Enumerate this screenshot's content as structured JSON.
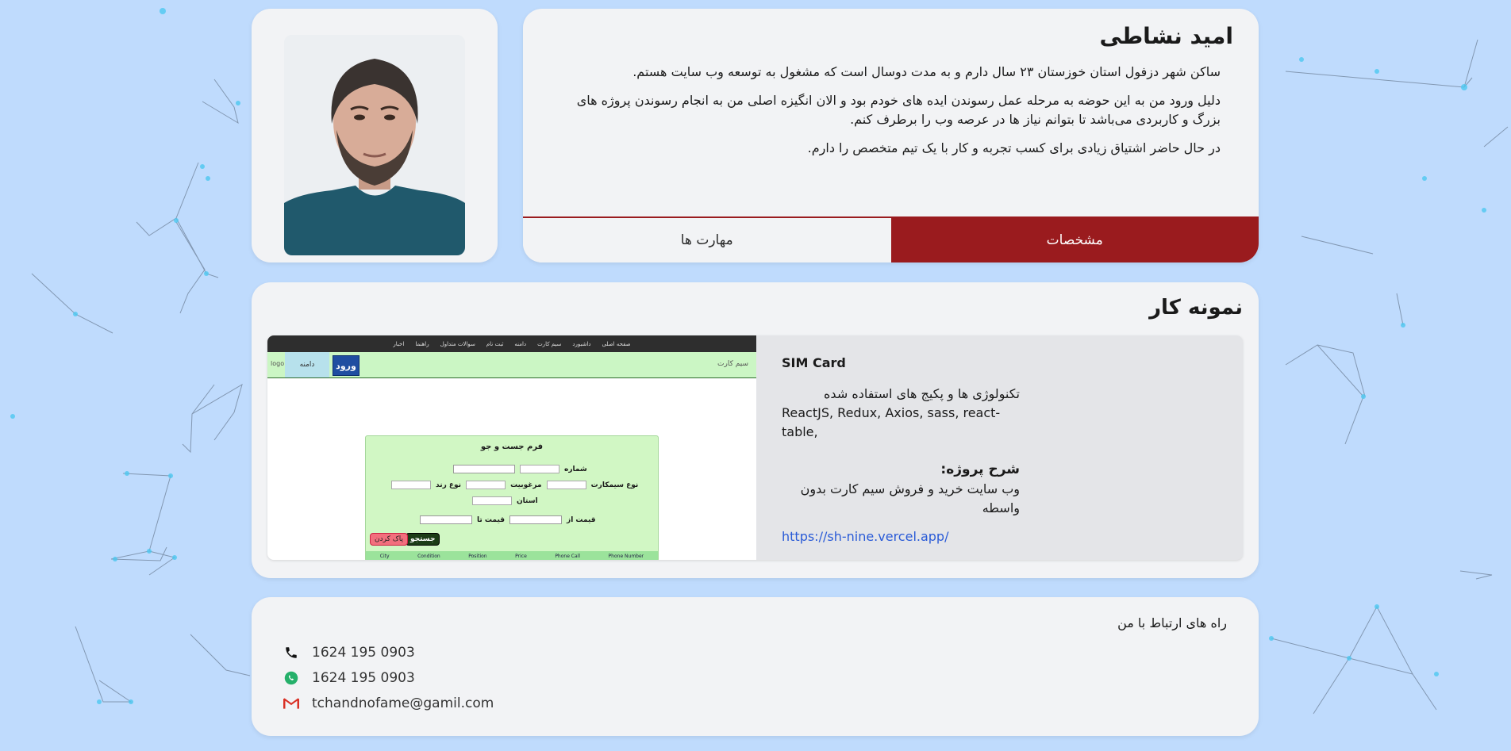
{
  "profile": {
    "name": "امید نشاطی",
    "paragraphs": [
      "ساکن شهر دزفول استان خوزستان ۲۳ سال دارم و به مدت دوسال است که مشغول به توسعه وب سایت هستم.",
      "دلیل ورود من به این حوضه به مرحله عمل رسوندن ایده های خودم بود و الان انگیزه اصلی من به انجام رسوندن پروژه های بزرگ و کاربردی می‌باشد تا بتوانم نیاز ها در عرصه وب را برطرف کنم.",
      "در حال حاضر اشتیاق زیادی برای کسب تجربه و کار با یک تیم متخصص را دارم."
    ],
    "tabs": {
      "skills": "مهارت ها",
      "specs": "مشخصات"
    },
    "active_tab": "specs"
  },
  "portfolio": {
    "title": "نمونه کار",
    "project": {
      "name": "SIM Card",
      "tech_title": "تکنولوژی ها و پکیج های استفاده شده",
      "tech": "ReactJS, Redux, Axios, sass, react-table,",
      "desc_title": "شرح پروژه:",
      "desc": "وب سایت خرید و فروش سیم کارت بدون واسطه",
      "link": "https://sh-nine.vercel.app/",
      "screenshot": {
        "nav": [
          "صفحه اصلی",
          "داشبورد",
          "سیم کارت",
          "دامنه",
          "ثبت نام",
          "سوالات متداول",
          "راهنما",
          "اخبار"
        ],
        "logo": "logo",
        "domain": "دامنه",
        "login": "ورود",
        "brand": "سیم کارت",
        "form_title": "فرم جست و جو",
        "number_label": "شماره",
        "simtype_label": "نوع سیمکارت",
        "status_label": "مرغوبیت",
        "pattern_label": "نوع رند",
        "province_label": "استان",
        "price_from_label": "قیمت از",
        "price_to_label": "قیمت تا",
        "search_btn": "جستجو",
        "clear_btn": "پاک کردن",
        "table_cols": [
          "City",
          "Condition",
          "Position",
          "Price",
          "Phone Call",
          "Phone Number"
        ]
      }
    }
  },
  "contact": {
    "title": "راه های ارتباط با من",
    "phone": "1624 195 0903",
    "whatsapp": "1624 195 0903",
    "email": "tchandnofame@gamil.com"
  },
  "colors": {
    "accent": "#9a1b1e",
    "background": "#bfdbfd",
    "card": "#f2f3f5",
    "link": "#2a5bd7"
  }
}
